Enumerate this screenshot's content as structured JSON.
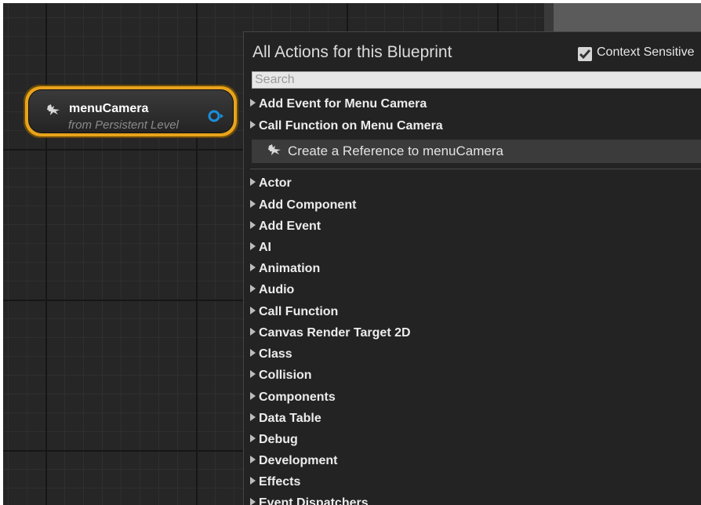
{
  "node": {
    "title": "menuCamera",
    "subtitle": "from Persistent Level",
    "icon": "camera-actor-icon",
    "pin_icon": "object-reference-pin-icon"
  },
  "menu": {
    "title": "All Actions for this Blueprint",
    "context_sensitive_label": "Context Sensitive",
    "context_sensitive_checked": true,
    "search_placeholder": "Search",
    "top_items": [
      "Add Event for Menu Camera",
      "Call Function on Menu Camera"
    ],
    "reference_item": "Create a Reference to menuCamera",
    "categories": [
      "Actor",
      "Add Component",
      "Add Event",
      "AI",
      "Animation",
      "Audio",
      "Call Function",
      "Canvas Render Target 2D",
      "Class",
      "Collision",
      "Components",
      "Data Table",
      "Debug",
      "Development",
      "Effects",
      "Event Dispatchers"
    ]
  },
  "colors": {
    "node_border": "#e8a31c",
    "pin": "#1a8fdc",
    "background": "#262626",
    "menu_bg": "#232323"
  }
}
